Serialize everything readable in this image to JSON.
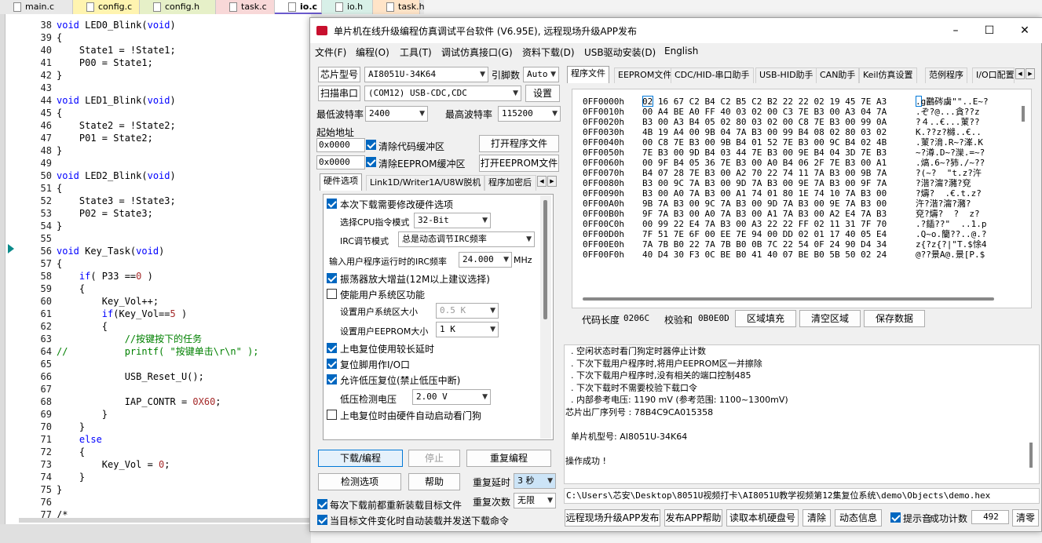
{
  "editor": {
    "tabs": [
      "main.c",
      "config.c",
      "config.h",
      "task.c",
      "io.c",
      "io.h",
      "task.h"
    ],
    "tab_colors": [
      "#e8e8e8",
      "#fff4b0",
      "#e6f0c8",
      "#f8d8d8",
      "#ffffff",
      "#d8f0e8",
      "#ffe4c8"
    ],
    "lines": [
      {
        "n": "38",
        "t": "void LED0_Blink(void)"
      },
      {
        "n": "39",
        "t": "{"
      },
      {
        "n": "40",
        "t": "    State1 = !State1;"
      },
      {
        "n": "41",
        "t": "    P00 = State1;"
      },
      {
        "n": "42",
        "t": "}"
      },
      {
        "n": "43",
        "t": ""
      },
      {
        "n": "44",
        "t": "void LED1_Blink(void)"
      },
      {
        "n": "45",
        "t": "{"
      },
      {
        "n": "46",
        "t": "    State2 = !State2;"
      },
      {
        "n": "47",
        "t": "    P01 = State2;"
      },
      {
        "n": "48",
        "t": "}"
      },
      {
        "n": "49",
        "t": ""
      },
      {
        "n": "50",
        "t": "void LED2_Blink(void)"
      },
      {
        "n": "51",
        "t": "{"
      },
      {
        "n": "52",
        "t": "    State3 = !State3;"
      },
      {
        "n": "53",
        "t": "    P02 = State3;"
      },
      {
        "n": "54",
        "t": "}"
      },
      {
        "n": "55",
        "t": ""
      },
      {
        "n": "56",
        "t": "void Key_Task(void)"
      },
      {
        "n": "57",
        "t": "{"
      },
      {
        "n": "58",
        "t": "    if( P33 ==0 )"
      },
      {
        "n": "59",
        "t": "    {"
      },
      {
        "n": "60",
        "t": "        Key_Vol++;"
      },
      {
        "n": "61",
        "t": "        if(Key_Vol==5 )"
      },
      {
        "n": "62",
        "t": "        {"
      },
      {
        "n": "63",
        "t": "            //按键按下的任务"
      },
      {
        "n": "64",
        "t": "//          printf( \"按键单击\\r\\n\" );"
      },
      {
        "n": "65",
        "t": ""
      },
      {
        "n": "66",
        "t": "            USB_Reset_U();"
      },
      {
        "n": "67",
        "t": ""
      },
      {
        "n": "68",
        "t": "            IAP_CONTR = 0X60;"
      },
      {
        "n": "69",
        "t": "        }"
      },
      {
        "n": "70",
        "t": "    }"
      },
      {
        "n": "71",
        "t": "    else"
      },
      {
        "n": "72",
        "t": "    {"
      },
      {
        "n": "73",
        "t": "        Key_Vol = 0;"
      },
      {
        "n": "74",
        "t": "    }"
      },
      {
        "n": "75",
        "t": "}"
      },
      {
        "n": "76",
        "t": ""
      },
      {
        "n": "77",
        "t": "/*"
      }
    ]
  },
  "isp": {
    "title": "单片机在线升级编程仿真调试平台软件 (V6.95E), 远程现场升级APP发布",
    "menu": [
      "文件(F)",
      "编程(O)",
      "工具(T)",
      "调试仿真接口(G)",
      "资料下载(D)",
      "USB驱动安装(D)",
      "English"
    ],
    "chip_label": "芯片型号",
    "chip_value": "AI8051U-34K64",
    "pin_label": "引脚数",
    "pin_value": "Auto",
    "scan_label": "扫描串口",
    "port_value": "(COM12) USB-CDC,CDC",
    "settings_btn": "设置",
    "min_baud_label": "最低波特率",
    "min_baud": "2400",
    "max_baud_label": "最高波特率",
    "max_baud": "115200",
    "start_addr_label": "起始地址",
    "addr1": "0x0000",
    "clear_code": "清除代码缓冲区",
    "open_prog": "打开程序文件",
    "addr2": "0x0000",
    "clear_eeprom": "清除EEPROM缓冲区",
    "open_eeprom": "打开EEPROM文件",
    "left_tabs": [
      "硬件选项",
      "Link1D/Writer1A/U8W脱机",
      "程序加密后"
    ],
    "opt_modify": "本次下载需要修改硬件选项",
    "cpu_mode_label": "选择CPU指令模式",
    "cpu_mode": "32-Bit",
    "irc_mode_label": "IRC调节模式",
    "irc_mode": "总是动态调节IRC频率",
    "irc_freq_label": "输入用户程序运行时的IRC频率",
    "irc_freq": "24.000",
    "irc_unit": "MHz",
    "osc_gain": "振荡器放大增益(12M以上建议选择)",
    "user_sys": "使能用户系统区功能",
    "sys_size_label": "设置用户系统区大小",
    "sys_size": "0.5 K",
    "eeprom_size_label": "设置用户EEPROM大小",
    "eeprom_size": "1   K",
    "power_delay": "上电复位使用较长延时",
    "reset_pin": "复位脚用作I/O口",
    "lvr": "允许低压复位(禁止低压中断)",
    "lvr_volt_label": "低压检测电压",
    "lvr_volt": "2.00 V",
    "wdt": "上电复位时由硬件自动启动看门狗",
    "download_btn": "下载/编程",
    "stop_btn": "停止",
    "reprog_btn": "重复编程",
    "detect_btn": "检测选项",
    "help_btn": "帮助",
    "repeat_delay_label": "重复延时",
    "repeat_delay": "3 秒",
    "repeat_count_label": "重复次数",
    "repeat_count": "无限",
    "reload_each": "每次下载前都重新装载目标文件",
    "auto_send": "当目标文件变化时自动装载并发送下载命令",
    "right_tabs": [
      "程序文件",
      "EEPROM文件",
      "CDC/HID-串口助手",
      "USB-HID助手",
      "CAN助手",
      "Keil仿真设置",
      "范例程序",
      "I/O口配置"
    ],
    "hex_rows": [
      {
        "a": "0FF0000h",
        "h": "02 16 67 C2 B4 C2 B5 C2 B2 22 22 02 19 45 7E A3",
        "s": ".g鸝硶虜\"\"..E~?"
      },
      {
        "a": "0FF0010h",
        "h": "00 A4 BE A0 FF 40 03 02 00 C3 7E B3 00 A3 04 7A",
        "s": ".ぞ?@...貪??z"
      },
      {
        "a": "0FF0020h",
        "h": "B3 00 A3 B4 05 02 80 03 02 00 C8 7E B3 00 99 0A",
        "s": "?４..€...菄??"
      },
      {
        "a": "0FF0030h",
        "h": "4B 19 A4 00 9B 04 7A B3 00 99 B4 08 02 80 03 02",
        "s": "K.??z?櫞..€.."
      },
      {
        "a": "0FF0040h",
        "h": "00 C8 7E B3 00 9B B4 01 52 7E B3 00 9C B4 02 4B",
        "s": ".菄?湇.R~?溄.K"
      },
      {
        "a": "0FF0050h",
        "h": "7E B3 00 9D B4 03 44 7E B3 00 9E B4 04 3D 7E B3",
        "s": "~?澊.D~?灤.=~?"
      },
      {
        "a": "0FF0060h",
        "h": "00 9F B4 05 36 7E B3 00 A0 B4 06 2F 7E B3 00 A1",
        "s": ".熇.6~?犻./~??"
      },
      {
        "a": "0FF0070h",
        "h": "B4 07 28 7E B3 00 A2 70 22 74 11 7A B3 00 9B 7A",
        "s": "?(~?  \"t.z?汻"
      },
      {
        "a": "0FF0080h",
        "h": "B3 00 9C 7A B3 00 9D 7A B3 00 9E 7A B3 00 9F 7A",
        "s": "?湝?澝?瀦?兗"
      },
      {
        "a": "0FF0090h",
        "h": "B3 00 A0 7A B3 00 A1 74 01 80 1E 74 10 7A B3 00",
        "s": "?燽?  .€.t.z?"
      },
      {
        "a": "0FF00A0h",
        "h": "9B 7A B3 00 9C 7A B3 00 9D 7A B3 00 9E 7A B3 00",
        "s": "汻?湝?澝?瀦?"
      },
      {
        "a": "0FF00B0h",
        "h": "9F 7A B3 00 A0 7A B3 00 A1 7A B3 00 A2 E4 7A B3",
        "s": "兗?燽?  ?  z?"
      },
      {
        "a": "0FF00C0h",
        "h": "00 99 22 E4 7A B3 00 A3 22 22 FF 02 11 31 7F 70",
        "s": ".?鍤??\"  ..1.p"
      },
      {
        "a": "0FF00D0h",
        "h": "7F 51 7E 6F 00 EE 7E 94 00 DD 02 01 17 40 05 E4",
        "s": ".Q~o.籣??..@.?"
      },
      {
        "a": "0FF00E0h",
        "h": "7A 7B B0 22 7A 7B B0 0B 7C 22 54 0F 24 90 D4 34",
        "s": "z{?z{?|\"T.$悇4"
      },
      {
        "a": "0FF00F0h",
        "h": "40 D4 30 F3 0C BE B0 41 40 07 BE B0 5B 50 02 24",
        "s": "@??景A@.景[P.$"
      }
    ],
    "code_len_label": "代码长度",
    "code_len": "0206C",
    "checksum_label": "校验和",
    "checksum": "0B0E0D",
    "fill_btn": "区域填充",
    "clear_area_btn": "清空区域",
    "save_btn": "保存数据",
    "log": [
      "  . 空闲状态时看门狗定时器停止计数",
      "  . 下次下载用户程序时,将用户EEPROM区一并擦除",
      "  . 下次下载用户程序时,没有相关的端口控制485",
      "  . 下次下载时不需要校验下载口令",
      "  . 内部参考电压: 1190 mV (参考范围: 1100~1300mV)",
      "芯片出厂序列号 : 78B4C9CA015358",
      "",
      "  单片机型号: AI8051U-34K64",
      "",
      "操作成功 !"
    ],
    "path": "C:\\Users\\芯安\\Desktop\\8051U视频打卡\\AI8051U教学视频第12集复位系统\\demo\\Objects\\demo.hex",
    "remote_btn": "远程现场升级APP发布",
    "publish_help_btn": "发布APP帮助",
    "read_disk_btn": "读取本机硬盘号",
    "clear_btn": "清除",
    "anim_btn": "动态信息",
    "beep_label": "提示音",
    "success_label": "成功计数",
    "success_count": "492",
    "reset_count_btn": "清零"
  }
}
